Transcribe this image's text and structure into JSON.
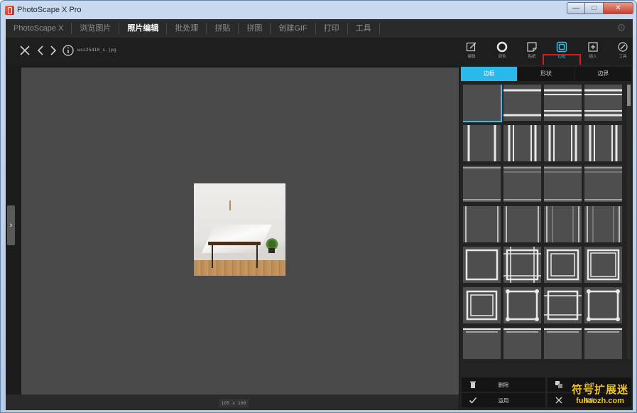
{
  "window": {
    "title": "PhotoScape X Pro",
    "min_label": "—",
    "max_label": "□",
    "close_label": "✕"
  },
  "menu": {
    "items": [
      {
        "label": "PhotoScape X",
        "active": false
      },
      {
        "label": "浏览图片",
        "active": false
      },
      {
        "label": "照片编辑",
        "active": true
      },
      {
        "label": "批处理",
        "active": false
      },
      {
        "label": "拼贴",
        "active": false
      },
      {
        "label": "拼图",
        "active": false
      },
      {
        "label": "创建GIF",
        "active": false
      },
      {
        "label": "打印",
        "active": false
      },
      {
        "label": "工具",
        "active": false
      }
    ],
    "settings_icon": "gear-icon"
  },
  "toolbar": {
    "filename": "wsc25410_s.jpg",
    "tools": [
      {
        "label": "编辑",
        "icon": "edit-icon"
      },
      {
        "label": "调色",
        "icon": "color-icon"
      },
      {
        "label": "贴纸",
        "icon": "sticker-icon"
      },
      {
        "label": "边框",
        "icon": "frame-icon",
        "selected": true
      },
      {
        "label": "插入",
        "icon": "insert-icon"
      },
      {
        "label": "工具",
        "icon": "tools-icon"
      }
    ],
    "highlight_color": "#d41e1e"
  },
  "canvas": {
    "image_size": "105 x 106",
    "background": "#4a4a4a"
  },
  "panel": {
    "tabs": [
      {
        "label": "边框",
        "active": true
      },
      {
        "label": "形状",
        "active": false
      },
      {
        "label": "边界",
        "active": false
      }
    ],
    "accent": "#29b9ea",
    "buttons": {
      "delete": "删除",
      "merge": "合并",
      "apply": "运用",
      "cancel": "取消"
    }
  },
  "watermark": {
    "cn": "符号扩展迷",
    "url": "fuhaozh.com"
  }
}
